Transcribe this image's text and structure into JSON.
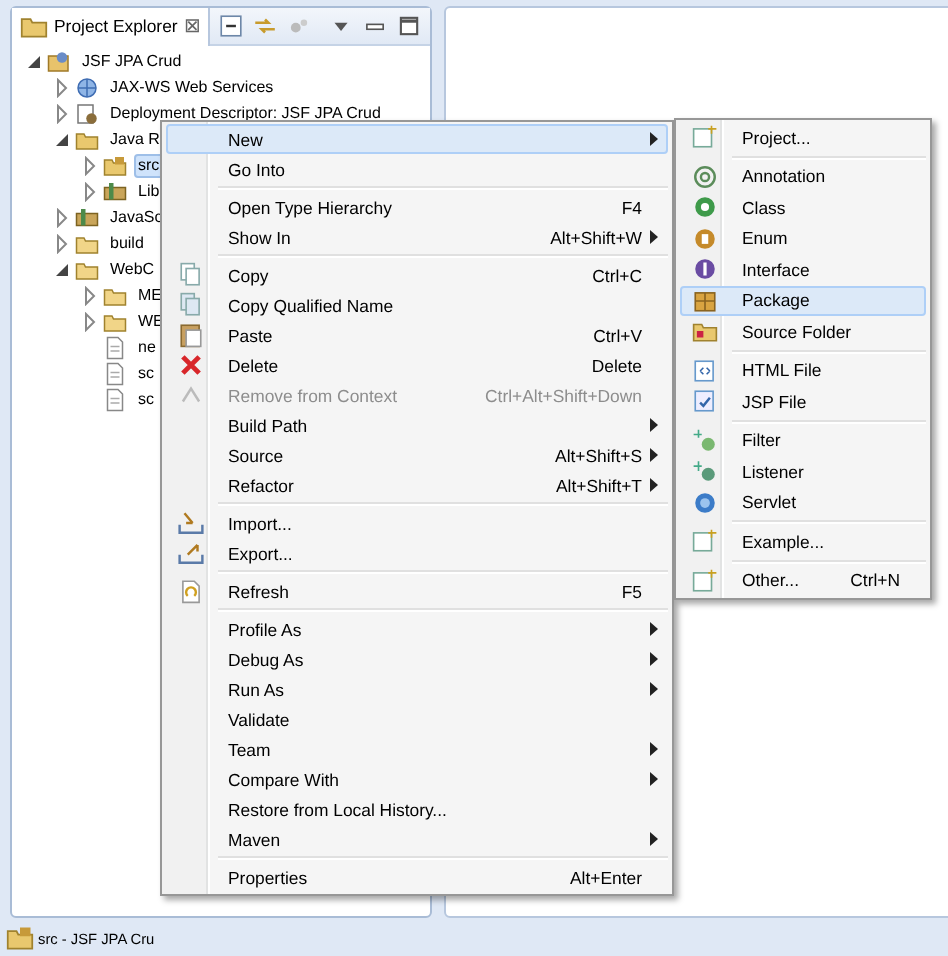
{
  "explorer": {
    "tab": {
      "label": "Project Explorer",
      "close": "⊠"
    },
    "tree": [
      {
        "label": "JSF JPA Crud",
        "kind": "project",
        "expanded": true,
        "selected": false,
        "children": [
          {
            "label": "JAX-WS Web Services",
            "kind": "services",
            "expanded": false,
            "selected": false
          },
          {
            "label": "Deployment Descriptor: JSF JPA Crud",
            "kind": "descriptor",
            "expanded": false,
            "selected": false
          },
          {
            "label": "Java R",
            "kind": "java-resources",
            "expanded": true,
            "selected": false,
            "children": [
              {
                "label": "src",
                "kind": "package-folder",
                "expanded": false,
                "selected": true
              },
              {
                "label": "Lib",
                "kind": "library",
                "expanded": false,
                "selected": false
              }
            ]
          },
          {
            "label": "JavaSc",
            "kind": "library",
            "expanded": false,
            "selected": false
          },
          {
            "label": "build",
            "kind": "folder",
            "expanded": false,
            "selected": false
          },
          {
            "label": "WebC",
            "kind": "folder",
            "expanded": true,
            "selected": false,
            "children": [
              {
                "label": "ME",
                "kind": "folder",
                "expanded": false,
                "selected": false
              },
              {
                "label": "WE",
                "kind": "folder",
                "expanded": false,
                "selected": false
              },
              {
                "label": "ne",
                "kind": "file",
                "selected": false
              },
              {
                "label": "sc",
                "kind": "file",
                "selected": false
              },
              {
                "label": "sc",
                "kind": "file",
                "selected": false
              }
            ]
          }
        ]
      }
    ]
  },
  "status_bar": {
    "text": "src - JSF JPA Cru"
  },
  "context_menu": [
    {
      "kind": "item",
      "label": "New",
      "submenu": true,
      "selected": true,
      "disabled": false
    },
    {
      "kind": "item",
      "label": "Go Into",
      "submenu": false,
      "selected": false,
      "disabled": false
    },
    {
      "kind": "separator"
    },
    {
      "kind": "item",
      "label": "Open Type Hierarchy",
      "shortcut": "F4",
      "submenu": false,
      "selected": false,
      "disabled": false
    },
    {
      "kind": "item",
      "label": "Show In",
      "shortcut": "Alt+Shift+W",
      "submenu": true,
      "selected": false,
      "disabled": false
    },
    {
      "kind": "separator"
    },
    {
      "kind": "item",
      "label": "Copy",
      "shortcut": "Ctrl+C",
      "submenu": false,
      "selected": false,
      "disabled": false
    },
    {
      "kind": "item",
      "label": "Copy Qualified Name",
      "submenu": false,
      "selected": false,
      "disabled": false
    },
    {
      "kind": "item",
      "label": "Paste",
      "shortcut": "Ctrl+V",
      "submenu": false,
      "selected": false,
      "disabled": false
    },
    {
      "kind": "item",
      "label": "Delete",
      "shortcut": "Delete",
      "submenu": false,
      "selected": false,
      "disabled": false
    },
    {
      "kind": "item",
      "label": "Remove from Context",
      "shortcut": "Ctrl+Alt+Shift+Down",
      "submenu": false,
      "selected": false,
      "disabled": true
    },
    {
      "kind": "item",
      "label": "Build Path",
      "submenu": true,
      "selected": false,
      "disabled": false
    },
    {
      "kind": "item",
      "label": "Source",
      "shortcut": "Alt+Shift+S",
      "submenu": true,
      "selected": false,
      "disabled": false
    },
    {
      "kind": "item",
      "label": "Refactor",
      "shortcut": "Alt+Shift+T",
      "submenu": true,
      "selected": false,
      "disabled": false
    },
    {
      "kind": "separator"
    },
    {
      "kind": "item",
      "label": "Import...",
      "submenu": false,
      "selected": false,
      "disabled": false
    },
    {
      "kind": "item",
      "label": "Export...",
      "submenu": false,
      "selected": false,
      "disabled": false
    },
    {
      "kind": "separator"
    },
    {
      "kind": "item",
      "label": "Refresh",
      "shortcut": "F5",
      "submenu": false,
      "selected": false,
      "disabled": false
    },
    {
      "kind": "separator"
    },
    {
      "kind": "item",
      "label": "Profile As",
      "submenu": true,
      "selected": false,
      "disabled": false
    },
    {
      "kind": "item",
      "label": "Debug As",
      "submenu": true,
      "selected": false,
      "disabled": false
    },
    {
      "kind": "item",
      "label": "Run As",
      "submenu": true,
      "selected": false,
      "disabled": false
    },
    {
      "kind": "item",
      "label": "Validate",
      "submenu": false,
      "selected": false,
      "disabled": false
    },
    {
      "kind": "item",
      "label": "Team",
      "submenu": true,
      "selected": false,
      "disabled": false
    },
    {
      "kind": "item",
      "label": "Compare With",
      "submenu": true,
      "selected": false,
      "disabled": false
    },
    {
      "kind": "item",
      "label": "Restore from Local History...",
      "submenu": false,
      "selected": false,
      "disabled": false
    },
    {
      "kind": "item",
      "label": "Maven",
      "submenu": true,
      "selected": false,
      "disabled": false
    },
    {
      "kind": "separator"
    },
    {
      "kind": "item",
      "label": "Properties",
      "shortcut": "Alt+Enter",
      "submenu": false,
      "selected": false,
      "disabled": false
    }
  ],
  "new_submenu": [
    {
      "kind": "item",
      "label": "Project...",
      "selected": false
    },
    {
      "kind": "separator"
    },
    {
      "kind": "item",
      "label": "Annotation",
      "selected": false
    },
    {
      "kind": "item",
      "label": "Class",
      "selected": false
    },
    {
      "kind": "item",
      "label": "Enum",
      "selected": false
    },
    {
      "kind": "item",
      "label": "Interface",
      "selected": false
    },
    {
      "kind": "item",
      "label": "Package",
      "selected": true
    },
    {
      "kind": "item",
      "label": "Source Folder",
      "selected": false
    },
    {
      "kind": "separator"
    },
    {
      "kind": "item",
      "label": "HTML File",
      "selected": false
    },
    {
      "kind": "item",
      "label": "JSP File",
      "selected": false
    },
    {
      "kind": "separator"
    },
    {
      "kind": "item",
      "label": "Filter",
      "selected": false
    },
    {
      "kind": "item",
      "label": "Listener",
      "selected": false
    },
    {
      "kind": "item",
      "label": "Servlet",
      "selected": false
    },
    {
      "kind": "separator"
    },
    {
      "kind": "item",
      "label": "Example...",
      "selected": false
    },
    {
      "kind": "separator"
    },
    {
      "kind": "item",
      "label": "Other...",
      "shortcut": "Ctrl+N",
      "selected": false
    }
  ]
}
